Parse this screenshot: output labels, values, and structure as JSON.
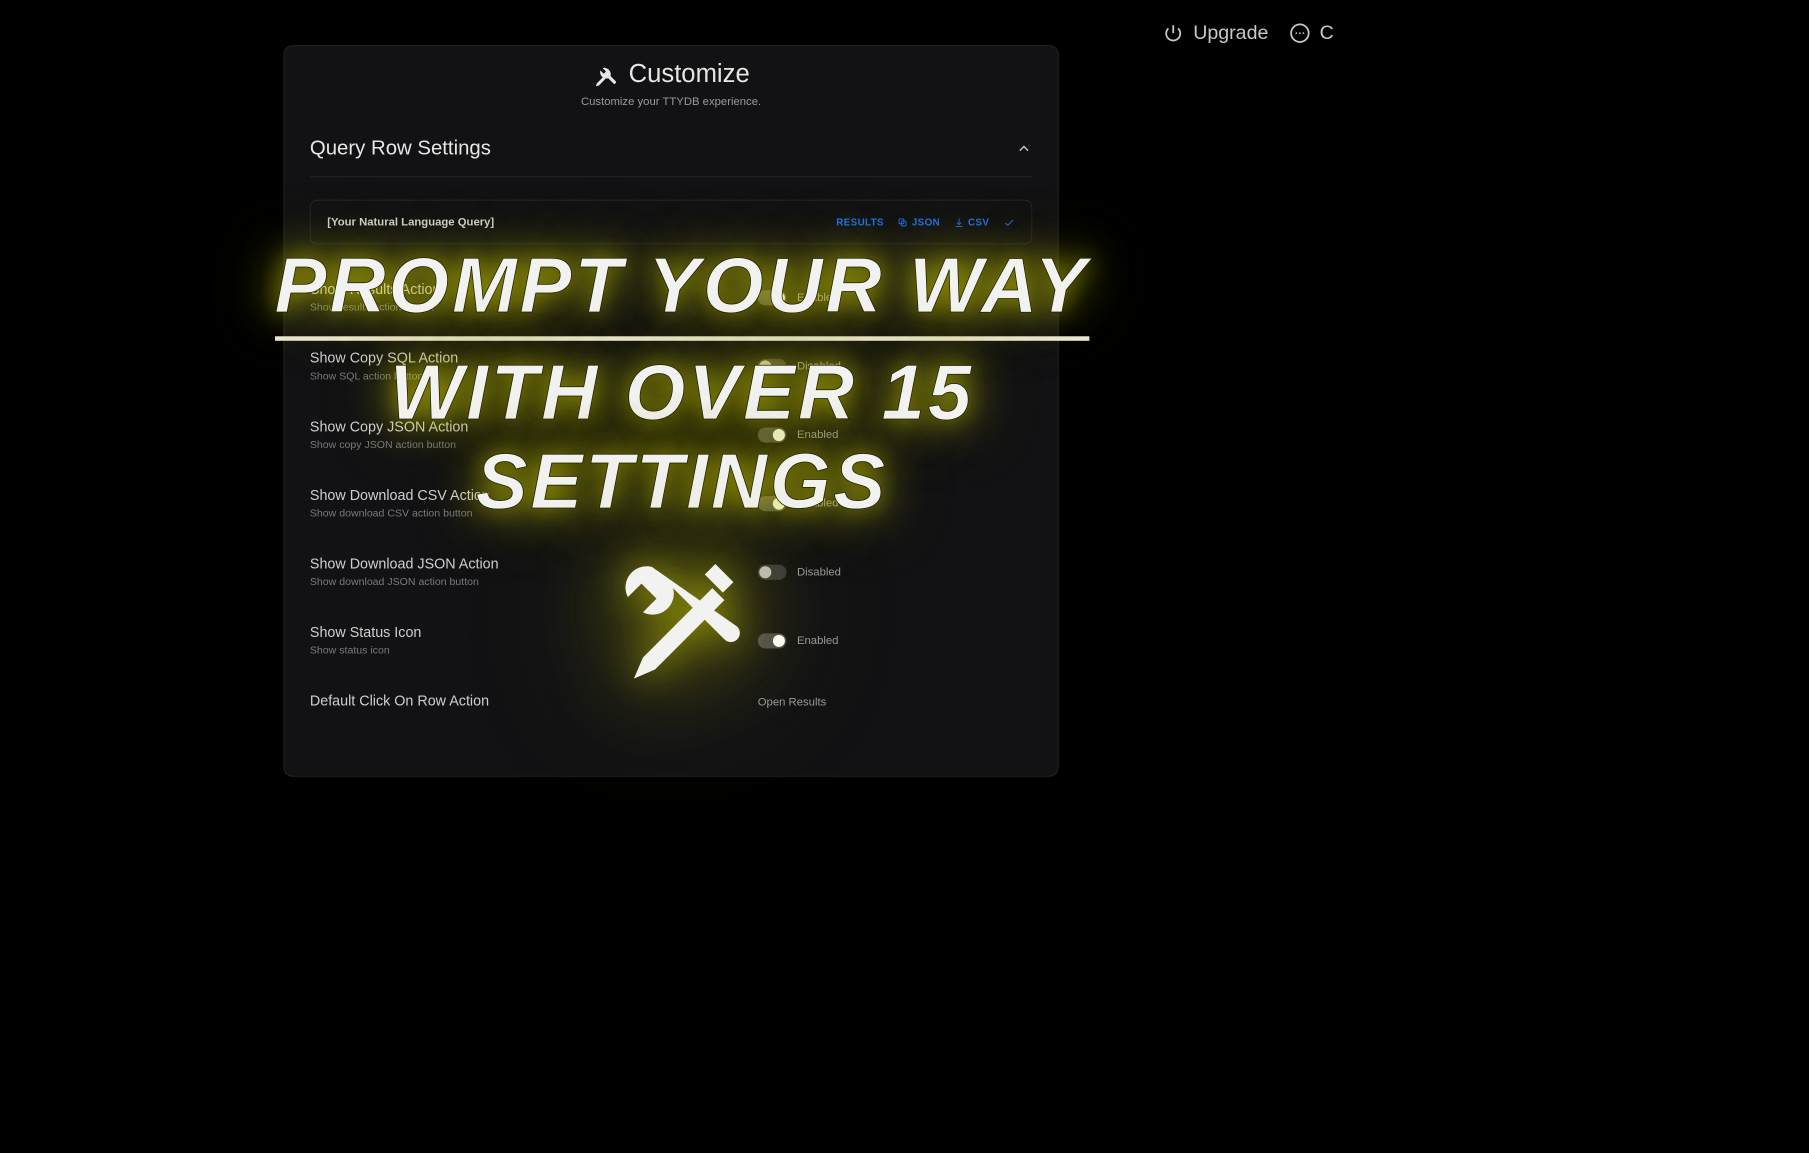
{
  "topbar": {
    "upgrade_label": "Upgrade",
    "right_label": "C"
  },
  "panel": {
    "title": "Customize",
    "subtitle": "Customize your TTYDB experience.",
    "section_title": "Query Row Settings",
    "preview": {
      "query_placeholder": "[Your Natural Language Query]",
      "actions": {
        "results": "RESULTS",
        "json": "JSON",
        "csv": "CSV"
      }
    },
    "settings": [
      {
        "title": "Show Results Action",
        "desc": "Show results action button",
        "enabled": true,
        "state_label": "Enabled"
      },
      {
        "title": "Show Copy SQL Action",
        "desc": "Show SQL action button",
        "enabled": false,
        "state_label": "Disabled"
      },
      {
        "title": "Show Copy JSON Action",
        "desc": "Show copy JSON action button",
        "enabled": true,
        "state_label": "Enabled"
      },
      {
        "title": "Show Download CSV Action",
        "desc": "Show download CSV action button",
        "enabled": true,
        "state_label": "Enabled"
      },
      {
        "title": "Show Download JSON Action",
        "desc": "Show download JSON action button",
        "enabled": false,
        "state_label": "Disabled"
      },
      {
        "title": "Show Status Icon",
        "desc": "Show status icon",
        "enabled": true,
        "state_label": "Enabled"
      }
    ],
    "default_click": {
      "title": "Default Click On Row Action",
      "value": "Open Results"
    }
  },
  "hero": {
    "line1": "PROMPT YOUR  WAY",
    "line2": "WITH OVER 15",
    "line3": "SETTINGS"
  }
}
